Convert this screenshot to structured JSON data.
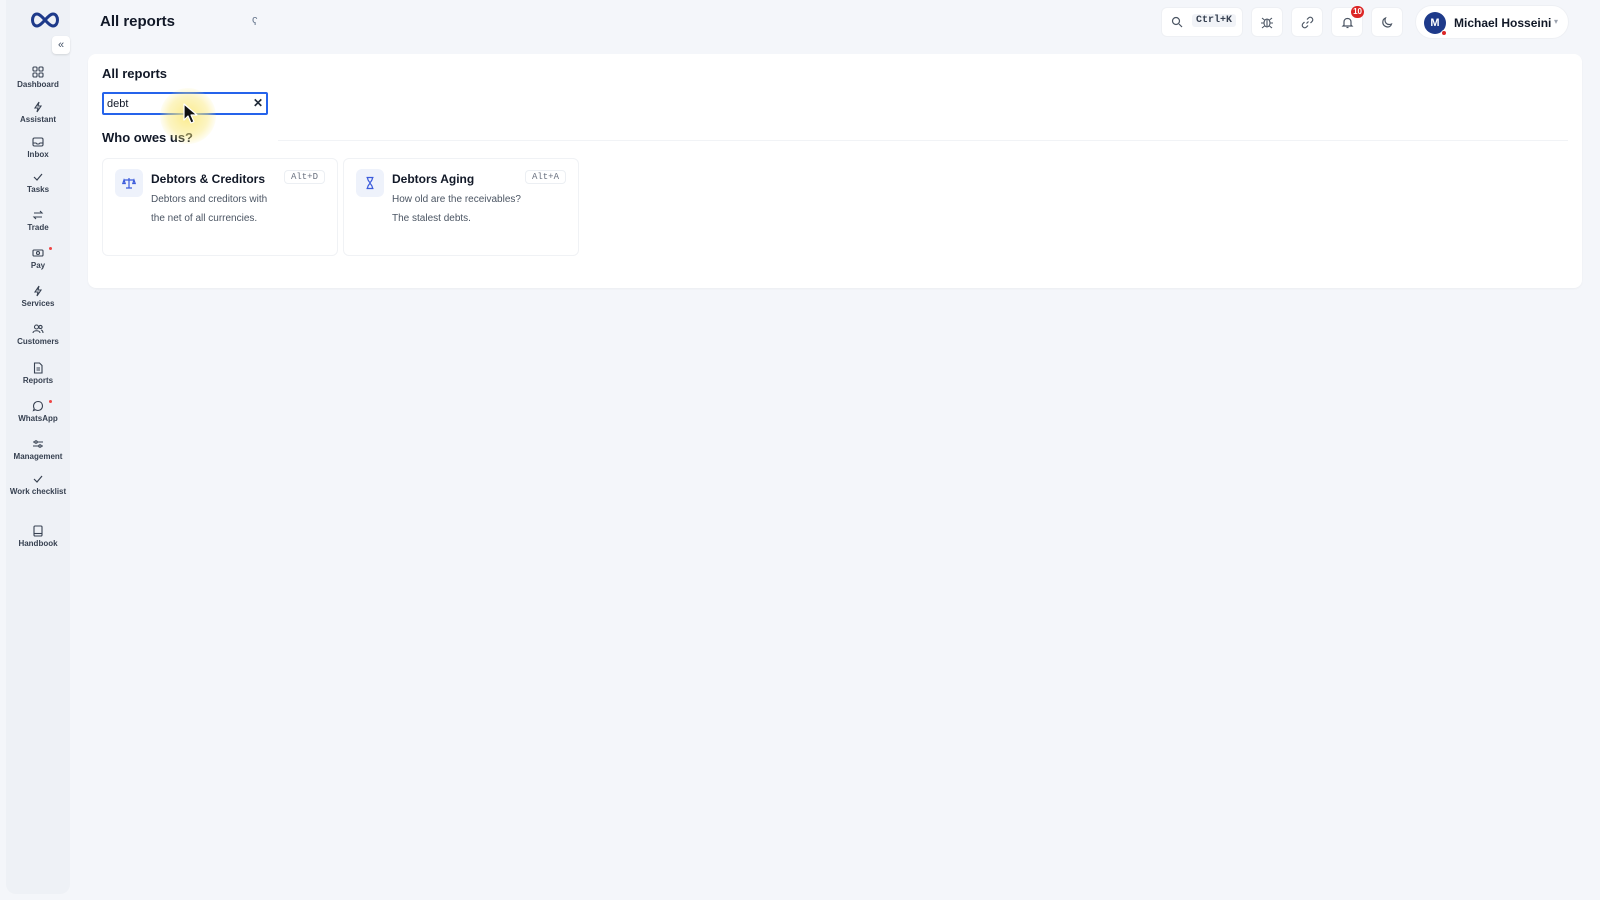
{
  "colors": {
    "accent": "#2563eb",
    "badge": "#dc2626",
    "avatar": "#1e3a8a",
    "icon": "#3b5bdb"
  },
  "sidebar": {
    "logo": "infinity-logo",
    "collapse_icon": "«",
    "items": [
      {
        "label": "Dashboard",
        "icon": "dashboard-icon"
      },
      {
        "label": "Assistant",
        "icon": "sparkle-icon"
      },
      {
        "label": "Inbox",
        "icon": "inbox-icon"
      },
      {
        "label": "Tasks",
        "icon": "check-icon"
      },
      {
        "label": "Trade",
        "icon": "swap-icon"
      },
      {
        "label": "Pay",
        "icon": "cash-icon",
        "dot": true
      },
      {
        "label": "Services",
        "icon": "bolt-icon"
      },
      {
        "label": "Customers",
        "icon": "users-icon"
      },
      {
        "label": "Reports",
        "icon": "report-icon"
      },
      {
        "label": "WhatsApp",
        "icon": "chat-icon",
        "dot": true
      },
      {
        "label": "Management",
        "icon": "sliders-icon"
      },
      {
        "label": "Work checklist",
        "icon": "check-icon"
      },
      {
        "label": "Handbook",
        "icon": "book-icon"
      }
    ]
  },
  "header": {
    "title": "All reports",
    "title_icon": "ʕ",
    "search_shortcut": "Ctrl+K",
    "notification_count": "10",
    "user": {
      "initial": "M",
      "name": "Michael Hosseini",
      "caret": "▾"
    }
  },
  "main": {
    "title": "All reports",
    "filter": {
      "value": "debt",
      "clear_icon": "✕"
    },
    "section_title": "Who owes us?",
    "reports": [
      {
        "title": "Debtors & Creditors",
        "description": "Debtors and creditors with the net of all currencies.",
        "shortcut": "Alt+D",
        "icon": "scale-icon"
      },
      {
        "title": "Debtors Aging",
        "description": "How old are the receivables? The stalest debts.",
        "shortcut": "Alt+A",
        "icon": "hourglass-icon"
      }
    ]
  }
}
